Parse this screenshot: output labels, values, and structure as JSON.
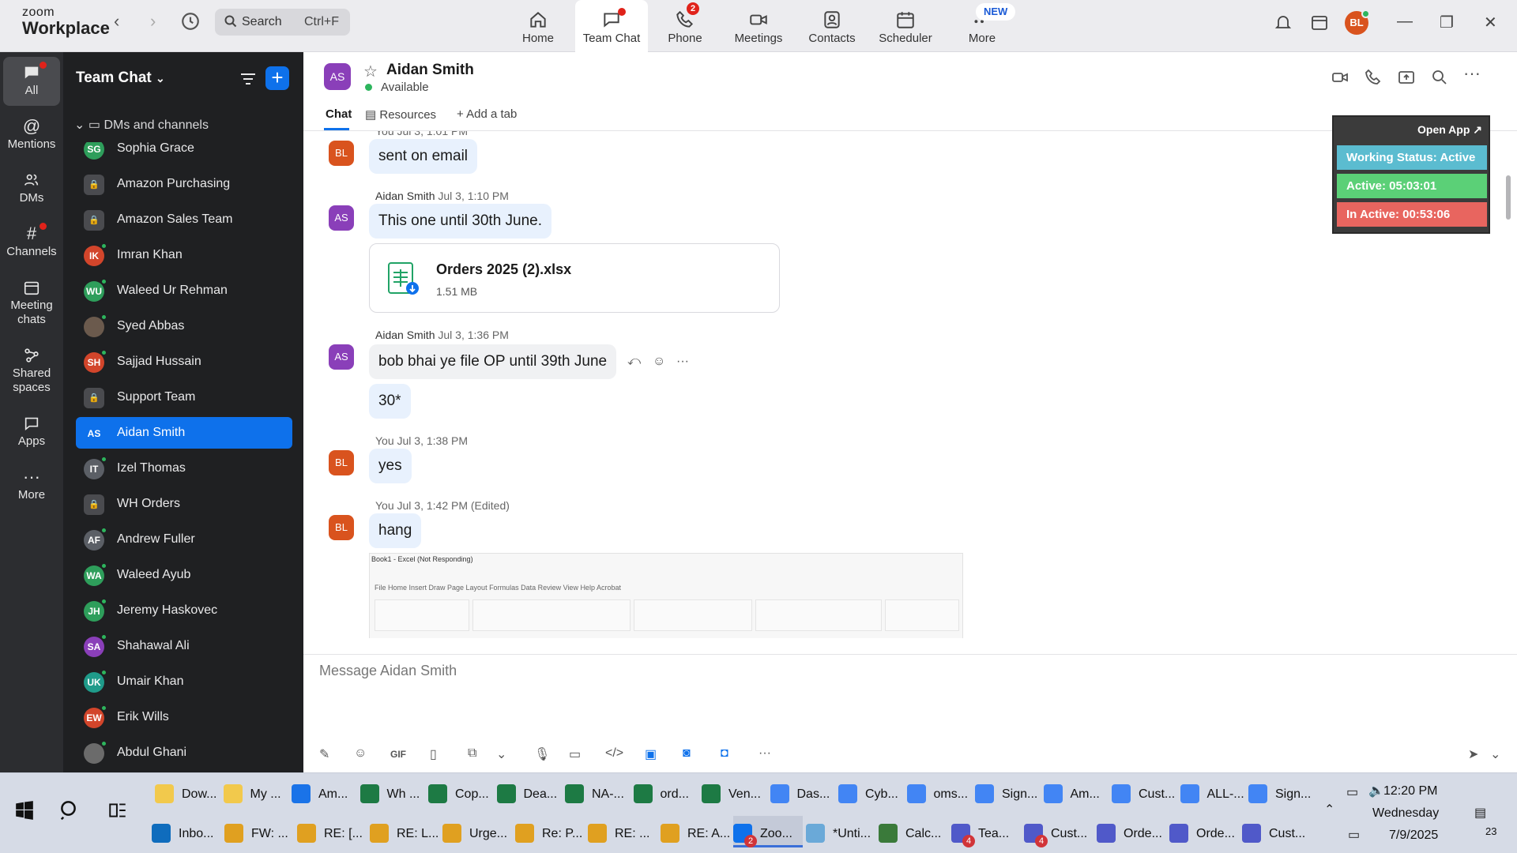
{
  "app": {
    "brand_top": "zoom",
    "brand_bottom": "Workplace"
  },
  "search": {
    "label": "Search",
    "shortcut": "Ctrl+F"
  },
  "nav_tabs": [
    {
      "label": "Home",
      "icon": "home-icon"
    },
    {
      "label": "Team Chat",
      "icon": "chat-icon",
      "active": true
    },
    {
      "label": "Phone",
      "icon": "phone-icon",
      "badge": "2"
    },
    {
      "label": "Meetings",
      "icon": "video-icon"
    },
    {
      "label": "Contacts",
      "icon": "contacts-icon"
    },
    {
      "label": "Scheduler",
      "icon": "calendar-icon"
    },
    {
      "label": "More",
      "icon": "more-icon",
      "new_badge": "NEW"
    }
  ],
  "user": {
    "initials": "BL"
  },
  "rail": [
    {
      "label": "All",
      "icon": "chat-bubble-icon"
    },
    {
      "label": "Mentions",
      "icon": "at-icon"
    },
    {
      "label": "DMs",
      "icon": "people-icon"
    },
    {
      "label": "Channels",
      "icon": "hash-icon"
    },
    {
      "label": "Meeting chats",
      "icon": "calendar-icon"
    },
    {
      "label": "Shared spaces",
      "icon": "shared-icon"
    },
    {
      "label": "Apps",
      "icon": "apps-icon"
    },
    {
      "label": "More",
      "icon": "ellipsis-icon"
    }
  ],
  "sidebar": {
    "title": "Team Chat",
    "section": "DMs and channels",
    "items": [
      {
        "initials": "SG",
        "name": "Sophia Grace",
        "color": "#2e9e5b",
        "presence": true
      },
      {
        "initials": "",
        "name": "Amazon Purchasing",
        "color": "#4a4b4f",
        "lock": true
      },
      {
        "initials": "",
        "name": "Amazon Sales Team",
        "color": "#4a4b4f",
        "lock": true
      },
      {
        "initials": "IK",
        "name": "Imran Khan",
        "color": "#d2452b",
        "presence": true
      },
      {
        "initials": "WU",
        "name": "Waleed Ur Rehman",
        "color": "#2e9e5b",
        "presence": true
      },
      {
        "initials": "",
        "name": "Syed Abbas",
        "color": "#6b5a4d",
        "presence": true,
        "photo": true
      },
      {
        "initials": "SH",
        "name": "Sajjad Hussain",
        "color": "#d2452b",
        "presence": true
      },
      {
        "initials": "",
        "name": "Support Team",
        "color": "#4a4b4f",
        "lock": true
      },
      {
        "initials": "AS",
        "name": "Aidan Smith",
        "color": "#0e71eb",
        "active": true
      },
      {
        "initials": "IT",
        "name": "Izel Thomas",
        "color": "#5b5f66",
        "presence": true
      },
      {
        "initials": "",
        "name": "WH Orders",
        "color": "#4a4b4f",
        "lock": true
      },
      {
        "initials": "AF",
        "name": "Andrew Fuller",
        "color": "#5b5f66",
        "presence": true
      },
      {
        "initials": "WA",
        "name": "Waleed Ayub",
        "color": "#2e9e5b",
        "presence": true
      },
      {
        "initials": "JH",
        "name": "Jeremy Haskovec",
        "color": "#2e9e5b",
        "presence": true
      },
      {
        "initials": "SA",
        "name": "Shahawal Ali",
        "color": "#8a3fb9",
        "presence": true
      },
      {
        "initials": "UK",
        "name": "Umair Khan",
        "color": "#1f9b8a",
        "presence": true
      },
      {
        "initials": "EW",
        "name": "Erik Wills",
        "color": "#d2452b",
        "presence": true
      },
      {
        "initials": "",
        "name": "Abdul Ghani",
        "color": "#6b6b6b",
        "presence": true,
        "photo": true
      }
    ]
  },
  "chat": {
    "initials": "AS",
    "name": "Aidan Smith",
    "status": "Available",
    "tabs": {
      "chat": "Chat",
      "resources": "Resources",
      "add": "Add a tab"
    },
    "composer_placeholder": "Message Aidan Smith"
  },
  "messages": {
    "m0_meta": "You Jul 3, 1:01 PM",
    "m0_text": "sent on email",
    "m1_who": "Aidan Smith",
    "m1_time": "Jul 3, 1:10 PM",
    "m1_text": "This one until 30th June.",
    "file_name": "Orders 2025 (2).xlsx",
    "file_size": "1.51 MB",
    "m2_who": "Aidan Smith",
    "m2_time": "Jul 3, 1:36 PM",
    "m2_text": "bob bhai ye file OP until 39th June",
    "m3_text": "30*",
    "m4_meta": "You Jul 3, 1:38 PM",
    "m4_text": "yes",
    "m5_meta": "You Jul 3, 1:42 PM (Edited)",
    "m5_text": "hang",
    "shot_title": "Book1 - Excel (Not Responding)",
    "shot_ribbon": "File    Home    Insert    Draw    Page Layout    Formulas    Data    Review    View    Help    Acrobat",
    "avatar_you": "BL",
    "avatar_them": "AS"
  },
  "widget": {
    "open_app": "Open App ↗",
    "working": "Working Status: Active",
    "active": "Active: 05:03:01",
    "inactive": "In Active: 00:53:06",
    "colors": {
      "working": "#5bbcd0",
      "active": "#5bd077",
      "inactive": "#e8655f"
    }
  },
  "taskbar": {
    "row1": [
      "Dow...",
      "My ...",
      "Am...",
      "Wh ...",
      "Cop...",
      "Dea...",
      "NA-...",
      "ord...",
      "Ven...",
      "Das...",
      "Cyb...",
      "oms...",
      "Sign...",
      "Am...",
      "Cust...",
      "ALL-...",
      "Sign..."
    ],
    "row2": [
      "Inbo...",
      "FW: ...",
      "RE: [...",
      "RE: L...",
      "Urge...",
      "Re: P...",
      "RE: ...",
      "RE: A...",
      "Zoo...",
      "*Unti...",
      "Calc...",
      "Tea...",
      "Cust...",
      "Orde...",
      "Orde...",
      "Cust..."
    ],
    "zoom_count": "2",
    "teams_count_a": "4",
    "teams_count_b": "4",
    "time": "12:20 PM",
    "day": "Wednesday",
    "date": "7/9/2025",
    "notif_count": "23"
  }
}
